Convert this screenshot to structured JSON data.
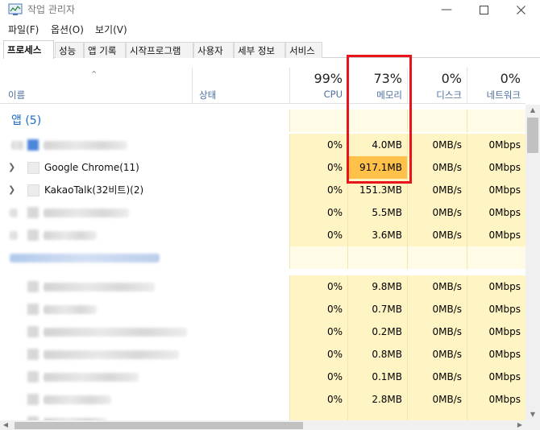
{
  "window": {
    "title": "작업 관리자",
    "minimize_icon": "minimize-icon",
    "maximize_icon": "maximize-icon",
    "close_icon": "close-icon"
  },
  "menu": [
    {
      "label": "파일(F)"
    },
    {
      "label": "옵션(O)"
    },
    {
      "label": "보기(V)"
    }
  ],
  "tabs": [
    {
      "label": "프로세스",
      "active": true
    },
    {
      "label": "성능"
    },
    {
      "label": "앱 기록"
    },
    {
      "label": "시작프로그램"
    },
    {
      "label": "사용자"
    },
    {
      "label": "세부 정보"
    },
    {
      "label": "서비스"
    }
  ],
  "columns": {
    "name": {
      "label": "이름"
    },
    "status": {
      "label": "상태"
    },
    "cpu": {
      "percent": "99%",
      "label": "CPU"
    },
    "memory": {
      "percent": "73%",
      "label": "메모리"
    },
    "disk": {
      "percent": "0%",
      "label": "디스크"
    },
    "network": {
      "percent": "0%",
      "label": "네트워크"
    }
  },
  "group": {
    "label": "앱 (5)"
  },
  "rows": [
    {
      "name": "",
      "cpu": "0%",
      "memory": "4.0MB",
      "disk": "0MB/s",
      "network": "0Mbps"
    },
    {
      "name": "Google Chrome(11)",
      "cpu": "0%",
      "memory": "917.1MB",
      "disk": "0MB/s",
      "network": "0Mbps",
      "memory_highlight": true
    },
    {
      "name": "KakaoTalk(32비트)(2)",
      "cpu": "0%",
      "memory": "151.3MB",
      "disk": "0MB/s",
      "network": "0Mbps"
    },
    {
      "name": "",
      "cpu": "0%",
      "memory": "5.5MB",
      "disk": "0MB/s",
      "network": "0Mbps"
    },
    {
      "name": "",
      "cpu": "0%",
      "memory": "3.6MB",
      "disk": "0MB/s",
      "network": "0Mbps"
    },
    {
      "name": "",
      "cpu": "0%",
      "memory": "9.8MB",
      "disk": "0MB/s",
      "network": "0Mbps"
    },
    {
      "name": "",
      "cpu": "0%",
      "memory": "0.7MB",
      "disk": "0MB/s",
      "network": "0Mbps"
    },
    {
      "name": "",
      "cpu": "0%",
      "memory": "0.2MB",
      "disk": "0MB/s",
      "network": "0Mbps"
    },
    {
      "name": "",
      "cpu": "0%",
      "memory": "0.8MB",
      "disk": "0MB/s",
      "network": "0Mbps"
    },
    {
      "name": "",
      "cpu": "0%",
      "memory": "0.1MB",
      "disk": "0MB/s",
      "network": "0Mbps"
    },
    {
      "name": "",
      "cpu": "0%",
      "memory": "2.8MB",
      "disk": "0MB/s",
      "network": "0Mbps"
    }
  ],
  "colors": {
    "heat_light": "#fff4c4",
    "heat_hot": "#ffc14a",
    "group_text": "#1e6cc7",
    "highlight_box": "#e8141c"
  }
}
